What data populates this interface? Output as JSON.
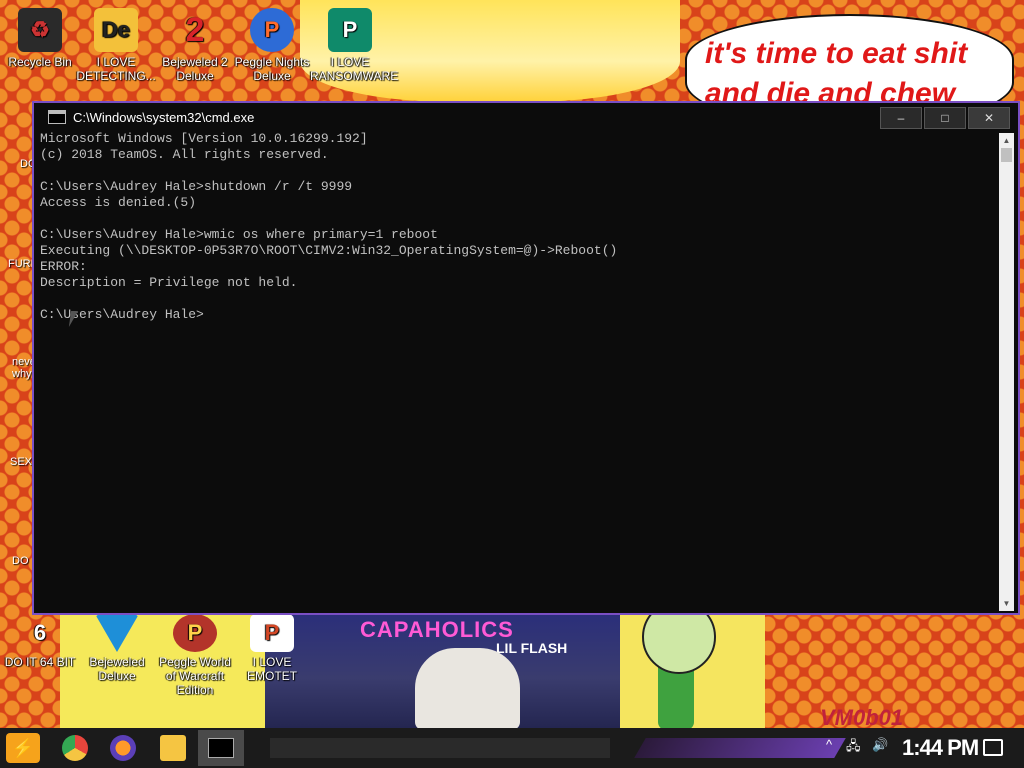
{
  "wallpaper": {
    "speech_text": "it's time to eat shit and die and chew",
    "album_title": "CAPAHOLICS",
    "album_artist": "LIL FLASH",
    "vm_tag": "VM0b01"
  },
  "desktop_icons_top": [
    {
      "label": "Recycle Bin",
      "icon": "recycle-bin-icon",
      "color": "#2a2a2a"
    },
    {
      "label": "I LOVE DETECTING...",
      "icon": "detecting-app-icon",
      "color": "#f3c13a"
    },
    {
      "label": "Bejeweled 2 Deluxe",
      "icon": "bejeweled-2-icon",
      "color": "#d8232a"
    },
    {
      "label": "Peggle Nights Deluxe",
      "icon": "peggle-nights-icon",
      "color": "#2d6bd6"
    },
    {
      "label": "I LOVE RANSOMWARE",
      "icon": "ransomware-doc-icon",
      "color": "#0f8a6a"
    }
  ],
  "desktop_icons_left_partial": [
    {
      "label": "DO",
      "icon": "chrome-icon"
    },
    {
      "label": "FURF",
      "icon": "firefox-icon"
    },
    {
      "label": "neve why",
      "icon": "doc-icon"
    },
    {
      "label": "SEX",
      "icon": "sex-app-icon"
    },
    {
      "label": "DO I",
      "icon": "face-icon"
    }
  ],
  "desktop_icons_bottom": [
    {
      "label": "DO IT 64 BIT",
      "icon": "face-64bit-icon"
    },
    {
      "label": "Bejeweled Deluxe",
      "icon": "bejeweled-icon"
    },
    {
      "label": "Peggle World of Warcraft Edition",
      "icon": "peggle-wow-icon"
    },
    {
      "label": "I LOVE EMOTET",
      "icon": "emotet-doc-icon"
    }
  ],
  "console_window": {
    "title": "C:\\Windows\\system32\\cmd.exe",
    "minimize_label": "–",
    "maximize_label": "□",
    "close_label": "✕",
    "output": "Microsoft Windows [Version 10.0.16299.192]\n(c) 2018 TeamOS. All rights reserved.\n\nC:\\Users\\Audrey Hale>shutdown /r /t 9999\nAccess is denied.(5)\n\nC:\\Users\\Audrey Hale>wmic os where primary=1 reboot\nExecuting (\\\\DESKTOP-0P53R7O\\ROOT\\CIMV2:Win32_OperatingSystem=@)->Reboot()\nERROR:\nDescription = Privilege not held.\n\nC:\\Users\\Audrey Hale>"
  },
  "taskbar": {
    "start_label": "⚡",
    "pinned": [
      {
        "name": "chrome",
        "color": "#e8453c"
      },
      {
        "name": "firefox",
        "color": "#ff7a1a"
      },
      {
        "name": "file-explorer",
        "color": "#f5c542"
      },
      {
        "name": "cmd",
        "color": "#000000"
      }
    ],
    "tray_chevron": "^",
    "tray_network": "🖧",
    "tray_volume": "🔊",
    "clock": "1:44 PM"
  }
}
